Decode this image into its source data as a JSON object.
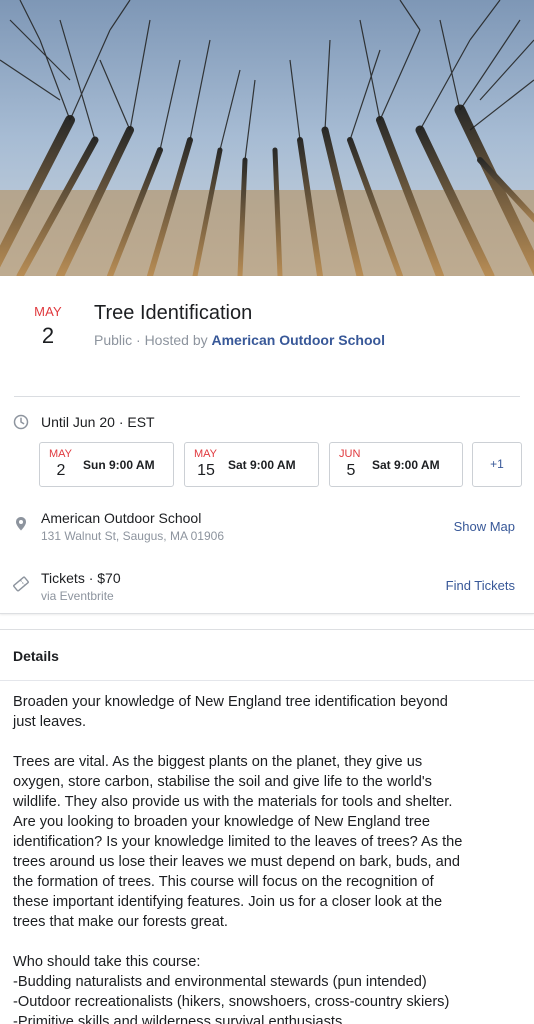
{
  "event": {
    "month": "MAY",
    "day": "2",
    "title": "Tree Identification",
    "privacy": "Public · Hosted by ",
    "host": "American Outdoor School"
  },
  "schedule": {
    "until": "Until Jun 20 · EST",
    "occurrences": [
      {
        "month": "MAY",
        "day": "2",
        "time": "Sun 9:00 AM"
      },
      {
        "month": "MAY",
        "day": "15",
        "time": "Sat 9:00 AM"
      },
      {
        "month": "JUN",
        "day": "5",
        "time": "Sat 9:00 AM"
      }
    ],
    "more": "+1"
  },
  "location": {
    "name": "American Outdoor School",
    "address": "131 Walnut St, Saugus, MA 01906",
    "map_link": "Show Map"
  },
  "tickets": {
    "label": "Tickets · $70",
    "source": "via Eventbrite",
    "link": "Find Tickets"
  },
  "details": {
    "heading": "Details",
    "paragraphs": [
      "Broaden your knowledge of New England tree identification beyond\njust leaves.",
      "Trees are vital. As the biggest plants on the planet, they give us\noxygen, store carbon, stabilise the soil and give life to the world's\nwildlife. They also provide us with the materials for tools and shelter.\nAre you looking to broaden your knowledge of New England tree\nidentification? Is your knowledge limited to the leaves of trees? As the\ntrees around us lose their leaves we must depend on bark, buds, and\nthe formation of trees. This course will focus on the recognition of\nthese important identifying features. Join us for a closer look at the\ntrees that make our forests great."
    ],
    "list_heading": "Who should take this course:",
    "list": [
      "-Budding naturalists and environmental stewards (pun intended)",
      "-Outdoor recreationalists (hikers, snowshoers, cross-country skiers)",
      "-Primitive skills and wilderness survival enthusiasts"
    ]
  },
  "icons": {
    "clock": "clock-icon",
    "location": "location-pin-icon",
    "ticket": "ticket-icon"
  },
  "colors": {
    "accent_red": "#e0393e",
    "link_blue": "#385898",
    "muted": "#8d949e"
  }
}
